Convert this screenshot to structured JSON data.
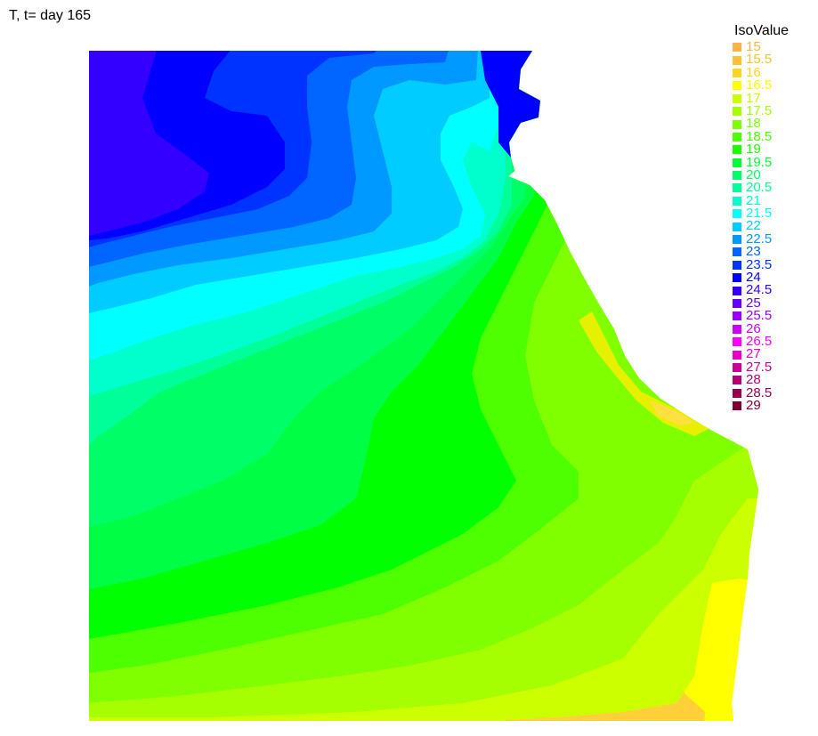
{
  "chart_data": {
    "type": "heatmap",
    "title": "T, t= day 165",
    "legend": {
      "title": "IsoValue",
      "placement": "right",
      "entries": [
        {
          "label": "15",
          "value": 15,
          "color": "#ffb347"
        },
        {
          "label": "15.5",
          "value": 15.5,
          "color": "#ffc033"
        },
        {
          "label": "16",
          "value": 16,
          "color": "#ffd520"
        },
        {
          "label": "16.5",
          "value": 16.5,
          "color": "#ffff00"
        },
        {
          "label": "17",
          "value": 17,
          "color": "#ccff00"
        },
        {
          "label": "17.5",
          "value": 17.5,
          "color": "#a6ff00"
        },
        {
          "label": "18",
          "value": 18,
          "color": "#80ff00"
        },
        {
          "label": "18.5",
          "value": 18.5,
          "color": "#4dff00"
        },
        {
          "label": "19",
          "value": 19,
          "color": "#1aff00"
        },
        {
          "label": "19.5",
          "value": 19.5,
          "color": "#00ff33"
        },
        {
          "label": "20",
          "value": 20,
          "color": "#00ff66"
        },
        {
          "label": "20.5",
          "value": 20.5,
          "color": "#00ff99"
        },
        {
          "label": "21",
          "value": 21,
          "color": "#00ffcc"
        },
        {
          "label": "21.5",
          "value": 21.5,
          "color": "#00ffff"
        },
        {
          "label": "22",
          "value": 22,
          "color": "#00ccff"
        },
        {
          "label": "22.5",
          "value": 22.5,
          "color": "#0099ff"
        },
        {
          "label": "23",
          "value": 23,
          "color": "#0066ff"
        },
        {
          "label": "23.5",
          "value": 23.5,
          "color": "#0033ff"
        },
        {
          "label": "24",
          "value": 24,
          "color": "#0000ff"
        },
        {
          "label": "24.5",
          "value": 24.5,
          "color": "#3300ff"
        },
        {
          "label": "25",
          "value": 25,
          "color": "#6600ff"
        },
        {
          "label": "25.5",
          "value": 25.5,
          "color": "#9900ff"
        },
        {
          "label": "26",
          "value": 26,
          "color": "#cc00ff"
        },
        {
          "label": "26.5",
          "value": 26.5,
          "color": "#ff00ff"
        },
        {
          "label": "27",
          "value": 27,
          "color": "#e600cc"
        },
        {
          "label": "27.5",
          "value": 27.5,
          "color": "#cc0099"
        },
        {
          "label": "28",
          "value": 28,
          "color": "#b30073"
        },
        {
          "label": "28.5",
          "value": 28.5,
          "color": "#99004d"
        },
        {
          "label": "29",
          "value": 29,
          "color": "#800033"
        }
      ]
    },
    "field": {
      "description": "filled isotherm contours over coastal basin",
      "levels_shown": [
        24.5,
        24,
        23.5,
        23,
        22.5,
        22,
        21.5,
        21,
        20.5,
        20,
        19.5,
        19,
        18.5,
        18,
        17.5,
        17,
        16.5,
        16,
        15.5
      ]
    }
  }
}
